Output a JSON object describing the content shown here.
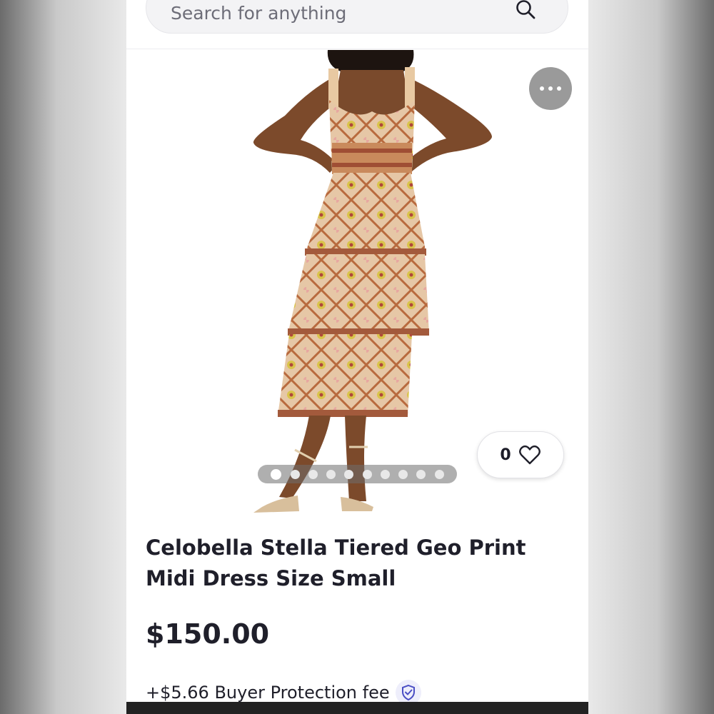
{
  "search": {
    "placeholder": "Search for anything"
  },
  "product": {
    "title": "Celobella Stella Tiered Geo Print Midi Dress Size Small",
    "price": "$150.00",
    "buyer_protection_fee": "+$5.66 Buyer Protection fee",
    "like_count": "0"
  },
  "carousel": {
    "total_images": 10,
    "active_index": 0
  },
  "icons": {
    "search": "search-icon",
    "more": "more-horizontal-icon",
    "like": "heart-icon",
    "protection": "shield-check-icon"
  },
  "colors": {
    "search_bg": "#f3f3f5",
    "more_button": "#9a9a9a",
    "text": "#1f1f2a",
    "shield_accent": "#4a4ec4"
  }
}
